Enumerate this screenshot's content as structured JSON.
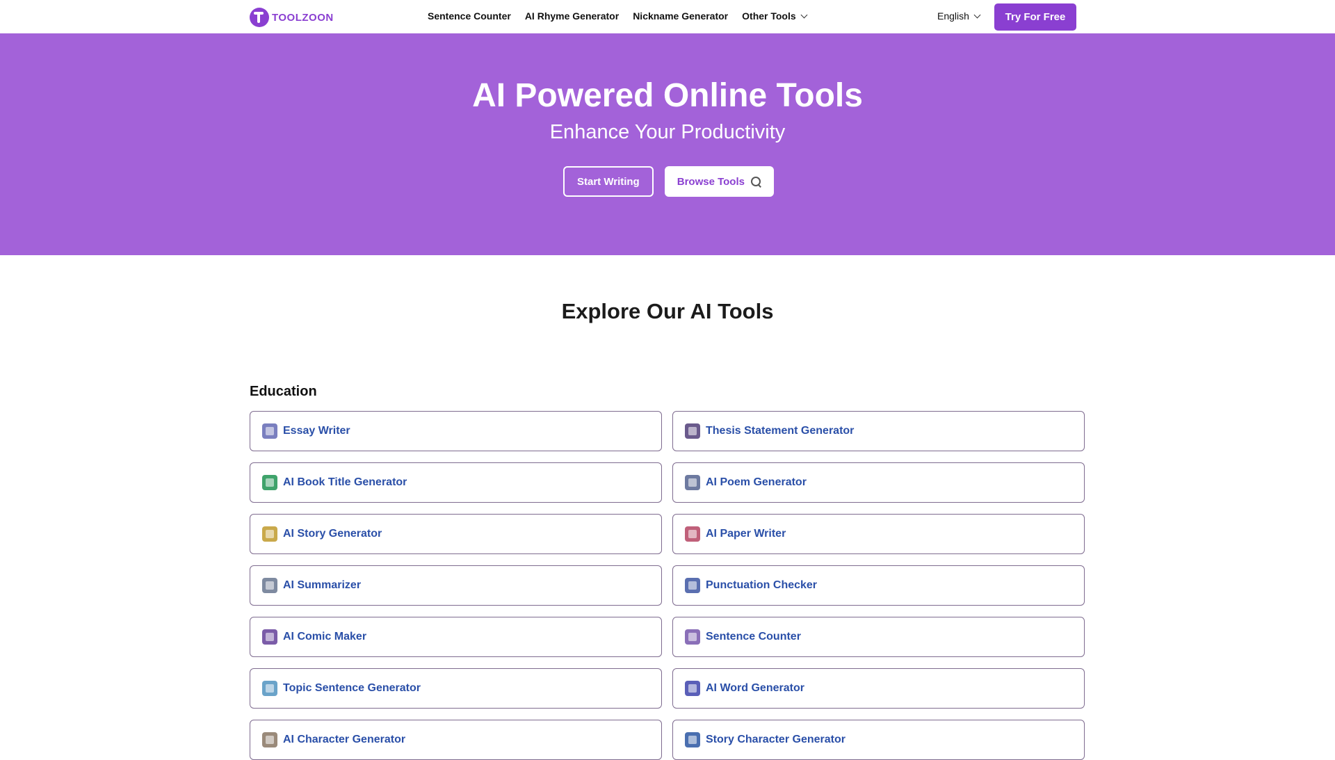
{
  "brand": {
    "name": "TOOLZOON",
    "color": "#8a3fd1"
  },
  "nav": {
    "links": [
      "Sentence Counter",
      "AI Rhyme Generator",
      "Nickname Generator",
      "Other Tools"
    ],
    "language": "English",
    "cta": "Try For Free"
  },
  "hero": {
    "title": "AI Powered Online Tools",
    "subtitle": "Enhance Your Productivity",
    "primary_button": "Start Writing",
    "secondary_button": "Browse Tools",
    "background": "#a362d9"
  },
  "explore": {
    "title": "Explore Our AI Tools",
    "section": "Education",
    "tools": [
      {
        "label": "Essay Writer",
        "icon": "document-icon",
        "color": "#7a7fbf"
      },
      {
        "label": "Thesis Statement Generator",
        "icon": "thesis-icon",
        "color": "#6a5a8c"
      },
      {
        "label": "AI Book Title Generator",
        "icon": "book-icon",
        "color": "#3fa36b"
      },
      {
        "label": "AI Poem Generator",
        "icon": "poem-icon",
        "color": "#6d7aa0"
      },
      {
        "label": "AI Story Generator",
        "icon": "typewriter-icon",
        "color": "#c9a94b"
      },
      {
        "label": "AI Paper Writer",
        "icon": "paper-pen-icon",
        "color": "#c0607a"
      },
      {
        "label": "AI Summarizer",
        "icon": "summarizer-icon",
        "color": "#7e8aa0"
      },
      {
        "label": "Punctuation Checker",
        "icon": "check-circle-icon",
        "color": "#5a6fb0"
      },
      {
        "label": "AI Comic Maker",
        "icon": "comic-icon",
        "color": "#7b5ca8"
      },
      {
        "label": "Sentence Counter",
        "icon": "magnifier-icon",
        "color": "#8a6fb8"
      },
      {
        "label": "Topic Sentence Generator",
        "icon": "topic-icon",
        "color": "#6aa3c9"
      },
      {
        "label": "AI Word Generator",
        "icon": "word-icon",
        "color": "#5a5fb8"
      },
      {
        "label": "AI Character Generator",
        "icon": "character-doc-icon",
        "color": "#9a8a7a"
      },
      {
        "label": "Story Character Generator",
        "icon": "characters-icon",
        "color": "#4a6fb0"
      }
    ]
  }
}
